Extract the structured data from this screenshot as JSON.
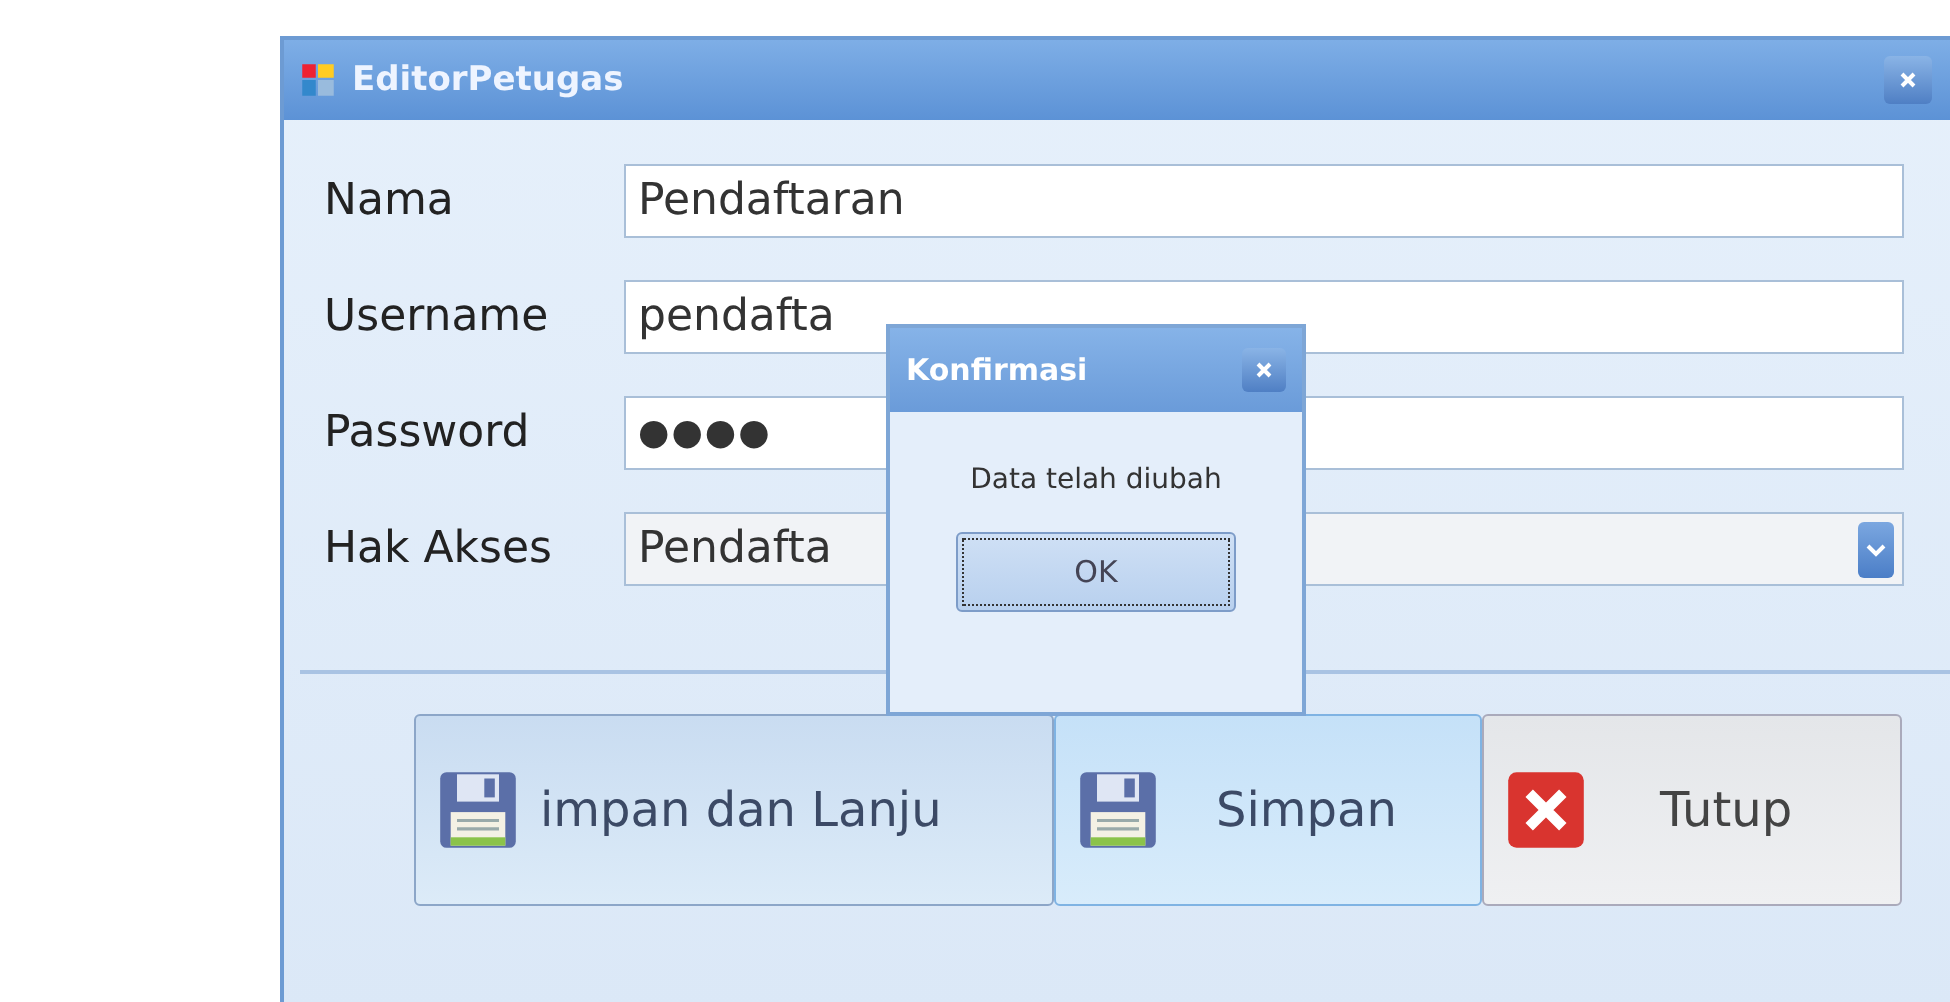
{
  "window": {
    "title": "EditorPetugas"
  },
  "fields": [
    {
      "kind": "text",
      "label": "Nama",
      "value": "Pendaftaran"
    },
    {
      "kind": "text",
      "label": "Username",
      "value": "pendafta"
    },
    {
      "kind": "password",
      "label": "Password",
      "value": "●●●●"
    },
    {
      "kind": "combo",
      "label": "Hak Akses",
      "value": "Pendafta"
    }
  ],
  "buttons": [
    {
      "kind": "save",
      "label": "impan dan Lanju"
    },
    {
      "kind": "save",
      "label": "Simpan"
    },
    {
      "kind": "close",
      "label": "Tutup"
    }
  ],
  "dialog": {
    "title": "Konfirmasi",
    "message": "Data telah diubah",
    "button": {
      "label": "OK",
      "focused": true
    }
  }
}
